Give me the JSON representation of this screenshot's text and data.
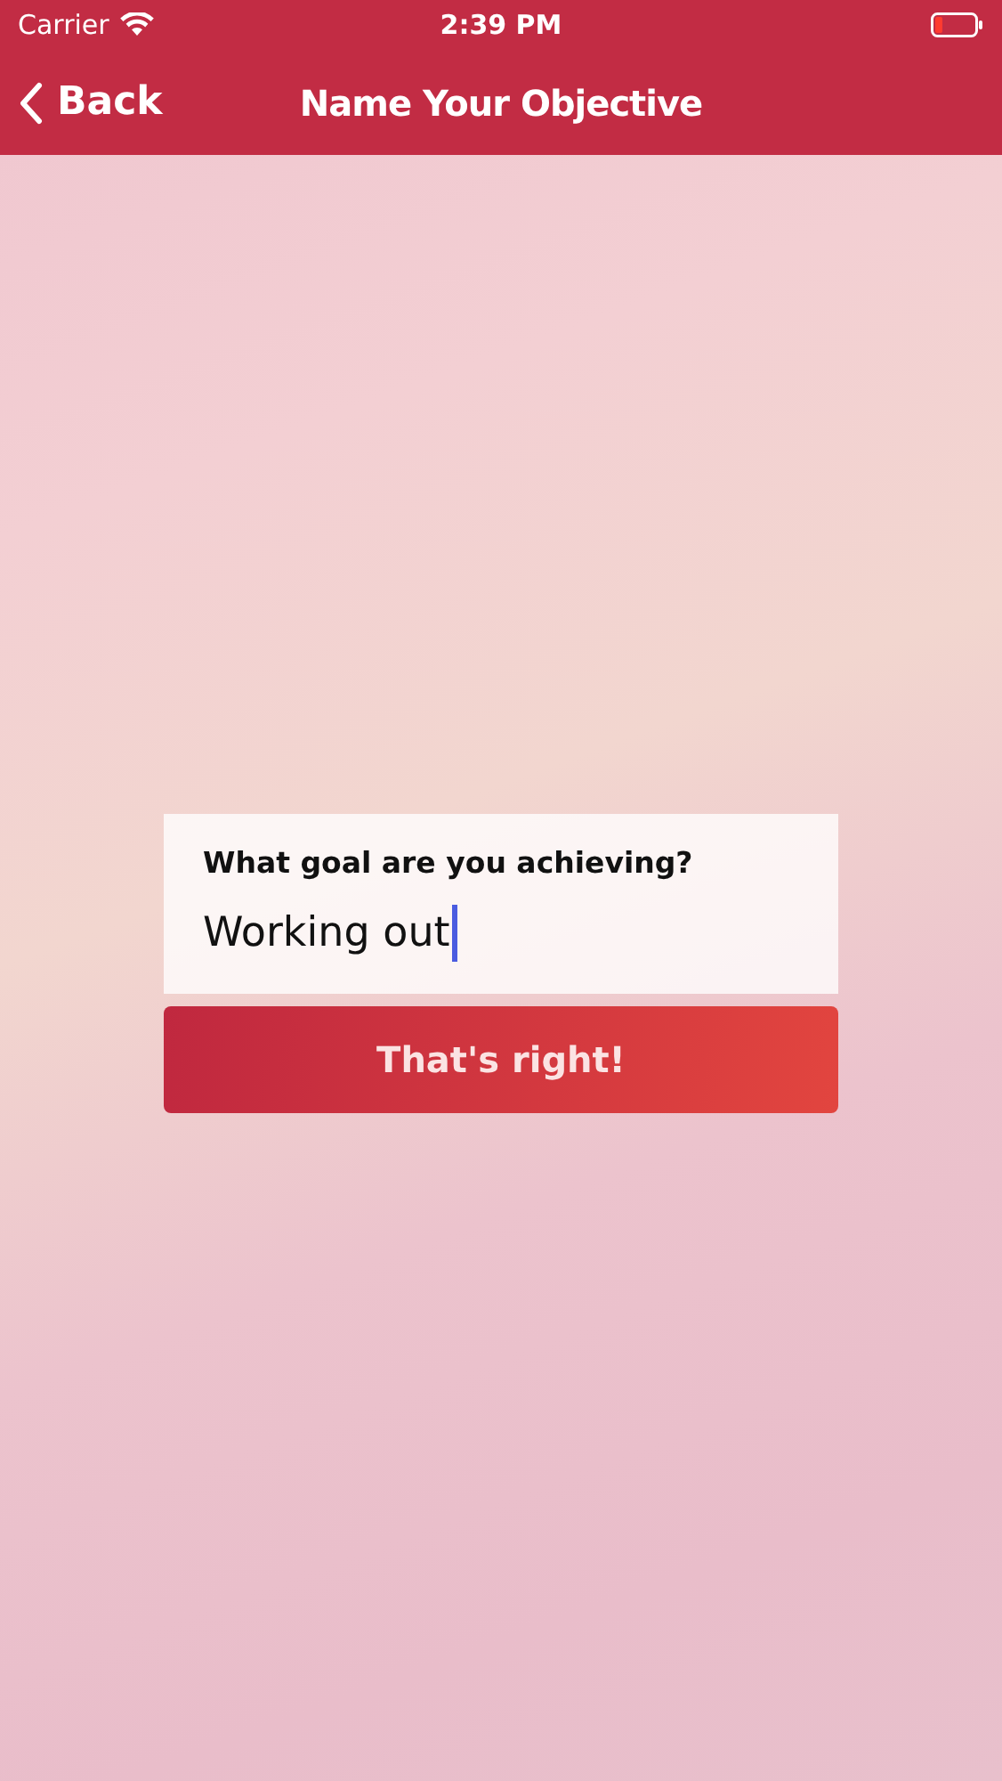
{
  "status_bar": {
    "carrier": "Carrier",
    "time": "2:39 PM"
  },
  "nav_bar": {
    "back_label": "Back",
    "title": "Name Your Objective"
  },
  "form": {
    "question": "What goal are you achieving?",
    "answer": {
      "value": "Working out"
    }
  },
  "confirm_button": {
    "label": "That's right!"
  }
}
